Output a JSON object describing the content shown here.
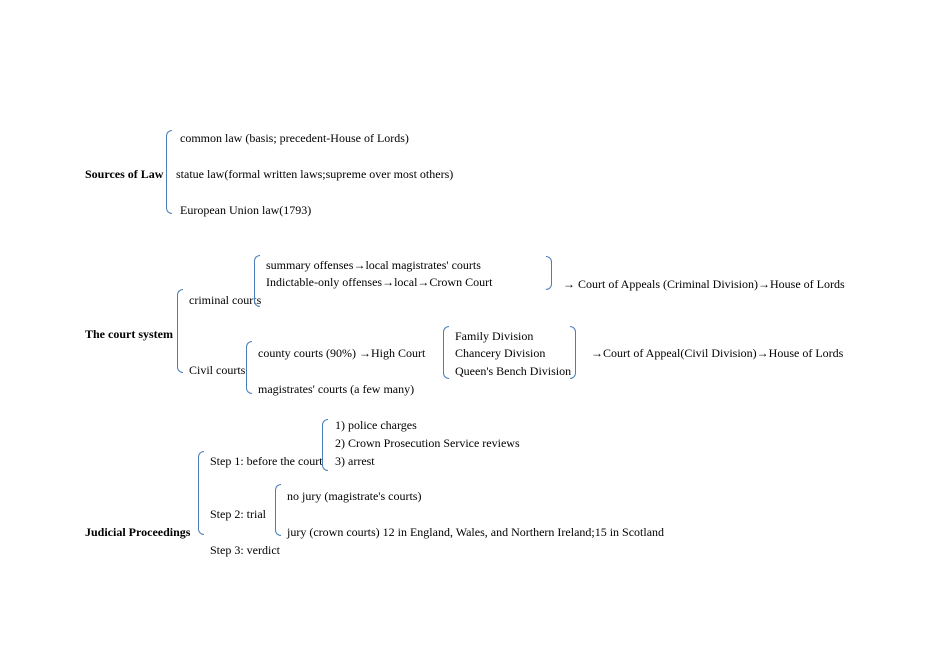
{
  "sources": {
    "title": "Sources of Law",
    "item1": "common law (basis; precedent-House of Lords)",
    "item2": "statue law(formal written laws;supreme over most others)",
    "item3": "European Union law(1793)"
  },
  "court": {
    "title": "The court system",
    "criminal_label": "criminal courts",
    "criminal_item1_a": "summary offenses",
    "criminal_item1_b": "local magistrates' courts",
    "criminal_item2_a": "Indictable-only offenses",
    "criminal_item2_b": "local",
    "criminal_item2_c": "Crown Court",
    "criminal_tail_a": " Court of Appeals (Criminal Division)",
    "criminal_tail_b": "House of Lords",
    "civil_label": "Civil courts",
    "civil_item1_a": "county courts (90%) ",
    "civil_item1_b": "High Court",
    "civil_item2": "magistrates' courts (a few many)",
    "div1": "Family Division",
    "div2": "Chancery Division",
    "div3": "Queen's Bench Division",
    "civil_tail_a": "Court of Appeal(Civil Division)",
    "civil_tail_b": "House of Lords"
  },
  "judicial": {
    "title": "Judicial Proceedings",
    "step1": "Step 1: before the court",
    "step1_item1": "1) police charges",
    "step1_item2": "2) Crown Prosecution Service reviews",
    "step1_item3": "3) arrest",
    "step2": "Step 2: trial",
    "step2_item1": "no jury (magistrate's courts)",
    "step2_item2": "jury (crown courts) 12 in England, Wales, and Northern Ireland;15 in Scotland",
    "step3": "Step 3: verdict"
  },
  "arrow": "→"
}
